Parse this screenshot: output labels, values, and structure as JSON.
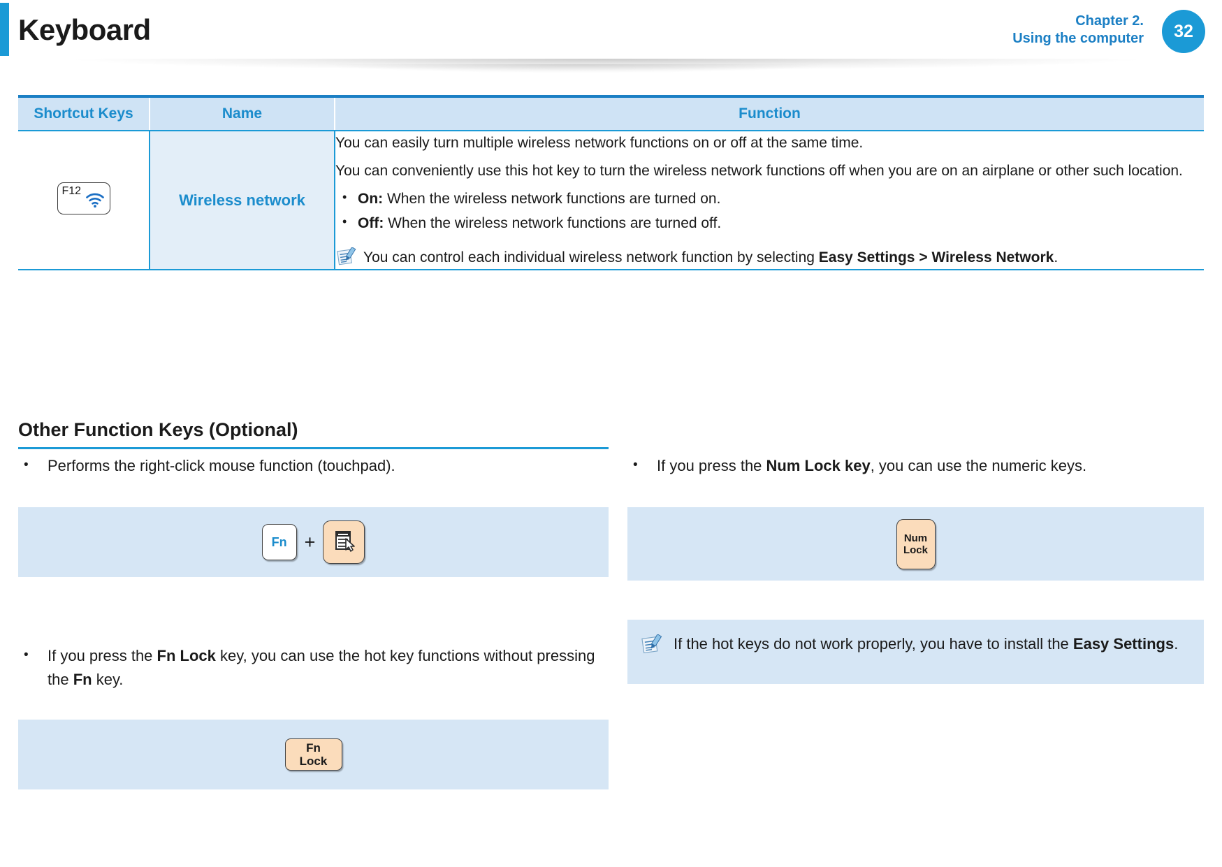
{
  "header": {
    "title": "Keyboard",
    "chapter_line1": "Chapter 2.",
    "chapter_line2": "Using the computer",
    "page_number": "32",
    "accent_color": "#1b9ad6",
    "title_color": "#1a1a1a"
  },
  "table": {
    "columns": [
      "Shortcut Keys",
      "Name",
      "Function"
    ],
    "rows": [
      {
        "key_label": "F12",
        "key_icon": "wifi-icon",
        "name": "Wireless network",
        "paragraphs": [
          "You can easily turn multiple wireless network functions on or off at the same time.",
          "You can conveniently use this hot key to turn the wireless network functions off when you are on an airplane or other such location."
        ],
        "bullets": [
          {
            "bold": "On:",
            "text": " When the wireless network functions are turned on."
          },
          {
            "bold": "Off:",
            "text": " When the wireless network functions are turned off."
          }
        ],
        "note": {
          "icon": "note-pen-icon",
          "prefix": "You can control each individual wireless network function by selecting ",
          "bold1": "Easy Settings >",
          "middle": " ",
          "bold2": "Wireless Network",
          "suffix": "."
        }
      }
    ]
  },
  "section": {
    "heading": "Other Function Keys (Optional)"
  },
  "left_column": {
    "item1": {
      "text": "Performs the right-click mouse function (touchpad).",
      "keys": {
        "fn_label": "Fn",
        "plus": "+",
        "second_key_icon": "context-menu-icon"
      }
    },
    "item2": {
      "prefix": "If you press the ",
      "bold1": "Fn Lock",
      "middle": " key, you can use the hot key functions without pressing the ",
      "bold2": "Fn",
      "suffix": " key.",
      "key": {
        "line1": "Fn",
        "line2": "Lock"
      }
    }
  },
  "right_column": {
    "item1": {
      "prefix": "If you press the ",
      "bold1": "Num Lock key",
      "suffix": ", you can use the numeric keys.",
      "key": {
        "line1": "Num",
        "line2": "Lock"
      }
    },
    "note": {
      "icon": "note-pen-icon",
      "prefix": "If the hot keys do not work properly, you have to install the ",
      "bold1": "Easy Settings",
      "suffix": "."
    }
  },
  "colors": {
    "brand_blue": "#1b9ad6",
    "heading_blue": "#1b8ccc",
    "panel_blue": "#d6e6f5",
    "table_header_blue": "#cfe3f5",
    "name_cell_blue": "#e3eef8",
    "key_tan": "#fbdcbb"
  }
}
